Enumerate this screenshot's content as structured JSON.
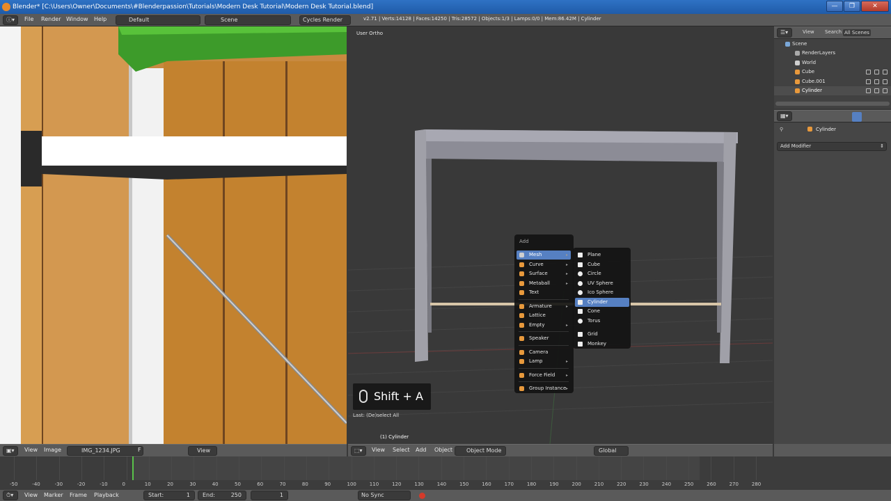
{
  "window": {
    "title": "Blender* [C:\\Users\\Owner\\Documents\\#Blenderpassion\\Tutorials\\Modern Desk Tutorial\\Modern Desk Tutorial.blend]",
    "min": "—",
    "max": "❐",
    "close": "✕"
  },
  "infobar": {
    "menus": [
      "File",
      "Render",
      "Window",
      "Help"
    ],
    "layout": "Default",
    "scene": "Scene",
    "engine": "Cycles Render",
    "stats": "v2.71 | Verts:14128 | Faces:14250 | Tris:28572 | Objects:1/3 | Lamps:0/0 | Mem:86.42M | Cylinder"
  },
  "viewport": {
    "label": "User Ortho",
    "object_label": "(1) Cylinder",
    "last_op": "Last: (De)select All",
    "shortcut": "Shift + A"
  },
  "add_menu": {
    "title": "Add",
    "items": [
      {
        "label": "Mesh",
        "icon": "mesh-icon",
        "sub": true,
        "selected": true
      },
      {
        "label": "Curve",
        "icon": "curve-icon",
        "sub": true
      },
      {
        "label": "Surface",
        "icon": "surface-icon",
        "sub": true
      },
      {
        "label": "Metaball",
        "icon": "metaball-icon",
        "sub": true
      },
      {
        "label": "Text",
        "icon": "text-icon",
        "sub": false
      },
      {
        "label": "Armature",
        "icon": "armature-icon",
        "sub": true
      },
      {
        "label": "Lattice",
        "icon": "lattice-icon",
        "sub": false
      },
      {
        "label": "Empty",
        "icon": "empty-icon",
        "sub": true
      },
      {
        "label": "Speaker",
        "icon": "speaker-icon",
        "sub": false
      },
      {
        "label": "Camera",
        "icon": "camera-icon",
        "sub": false
      },
      {
        "label": "Lamp",
        "icon": "lamp-icon",
        "sub": true
      },
      {
        "label": "Force Field",
        "icon": "force-field-icon",
        "sub": true
      },
      {
        "label": "Group Instance",
        "icon": "group-instance-icon",
        "sub": true
      }
    ]
  },
  "mesh_menu": {
    "items": [
      {
        "label": "Plane",
        "icon": "plane-icon"
      },
      {
        "label": "Cube",
        "icon": "cube-icon"
      },
      {
        "label": "Circle",
        "icon": "circle-icon"
      },
      {
        "label": "UV Sphere",
        "icon": "uv-sphere-icon"
      },
      {
        "label": "Ico Sphere",
        "icon": "ico-sphere-icon"
      },
      {
        "label": "Cylinder",
        "icon": "cylinder-icon",
        "selected": true
      },
      {
        "label": "Cone",
        "icon": "cone-icon"
      },
      {
        "label": "Torus",
        "icon": "torus-icon"
      },
      {
        "label": "Grid",
        "icon": "grid-icon"
      },
      {
        "label": "Monkey",
        "icon": "monkey-icon"
      }
    ]
  },
  "outliner": {
    "tabs": [
      "View",
      "Search",
      "All Scenes"
    ],
    "rows": [
      "Scene",
      "RenderLayers",
      "World",
      "Cube",
      "Cube.001",
      "Cylinder"
    ]
  },
  "properties": {
    "object": "Cylinder",
    "add_modifier": "Add Modifier"
  },
  "image_editor": {
    "menus": [
      "View",
      "Image"
    ],
    "image_name": "IMG_1234.JPG",
    "f_label": "F",
    "view": "View"
  },
  "viewport_header": {
    "menus": [
      "View",
      "Select",
      "Add",
      "Object"
    ],
    "mode": "Object Mode",
    "orientation": "Global"
  },
  "timeline": {
    "ticks": [
      "-50",
      "-40",
      "-30",
      "-20",
      "-10",
      "0",
      "10",
      "20",
      "30",
      "40",
      "50",
      "60",
      "70",
      "80",
      "90",
      "100",
      "110",
      "120",
      "130",
      "140",
      "150",
      "160",
      "170",
      "180",
      "190",
      "200",
      "210",
      "220",
      "230",
      "240",
      "250",
      "260",
      "270",
      "280"
    ],
    "menus": [
      "View",
      "Marker",
      "Frame",
      "Playback"
    ],
    "start": "Start:",
    "start_val": "1",
    "end": "End:",
    "end_val": "250",
    "current": "1",
    "sync": "No Sync"
  },
  "colors": {
    "accent": "#5680c2",
    "header": "#5a5a5a",
    "viewport_bg": "#393939"
  }
}
